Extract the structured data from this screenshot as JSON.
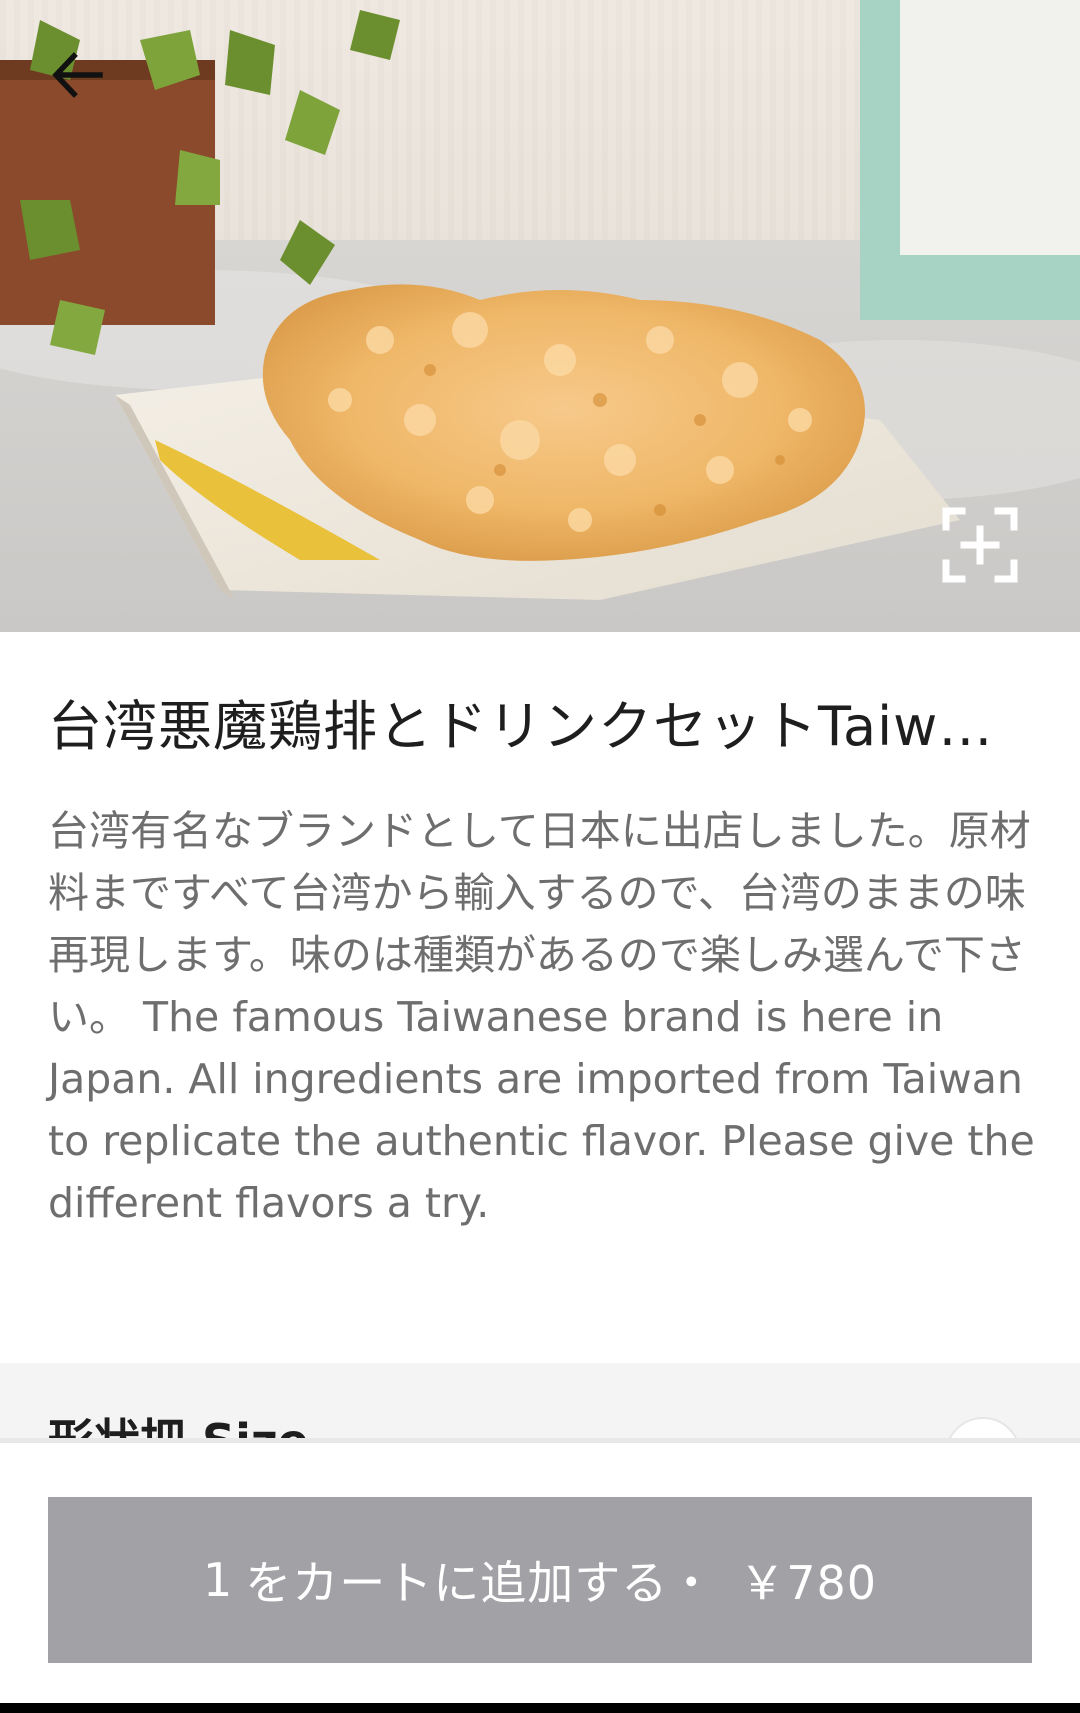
{
  "header": {
    "back_icon": "arrow-left-icon",
    "expand_icon": "expand-icon"
  },
  "item": {
    "title": "台湾悪魔鶏排とドリンクセットTaiwanese Devil Chicken Steak & Drink Set",
    "description": "台湾有名なブランドとして日本に出店しました。原材料まですべて台湾から輸入するので、台湾のままの味再現します。味のは種類があるので楽しみ選んで下さい。 The famous Taiwanese brand is here in Japan. All ingredients are imported from Taiwan to replicate the authentic flavor. Please give the different flavors a try."
  },
  "options": {
    "section_title": "形状把 Size"
  },
  "cart": {
    "quantity": "1",
    "label": "をカートに追加する・",
    "price": "￥780"
  },
  "colors": {
    "button_bg": "#a2a2a6",
    "title_text": "#1e1e1e",
    "description_text": "#6e6e6e",
    "section_bg": "#f4f4f4"
  }
}
